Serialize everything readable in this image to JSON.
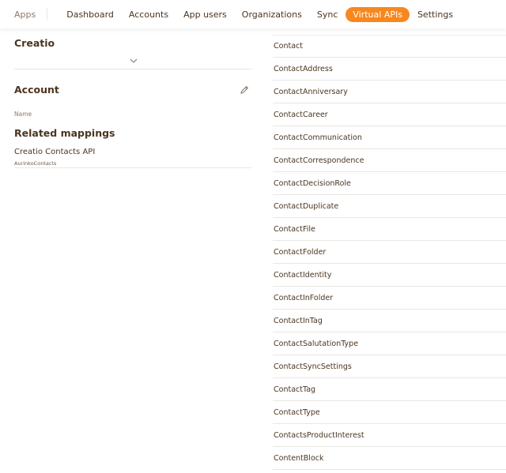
{
  "nav": {
    "apps_label": "Apps",
    "items": [
      {
        "label": "Dashboard",
        "active": false
      },
      {
        "label": "Accounts",
        "active": false
      },
      {
        "label": "App users",
        "active": false
      },
      {
        "label": "Organizations",
        "active": false
      },
      {
        "label": "Sync",
        "active": false
      },
      {
        "label": "Virtual APIs",
        "active": true
      },
      {
        "label": "Settings",
        "active": false
      }
    ],
    "accent_color": "#f7881f"
  },
  "left_panel": {
    "provider_title": "Creatio",
    "section_title": "Account",
    "name_label": "Name",
    "related_title": "Related mappings",
    "mapping": {
      "title": "Creatio Contacts API",
      "subtitle": "AurinkoContacts"
    }
  },
  "entities": [
    "Contact",
    "ContactAddress",
    "ContactAnniversary",
    "ContactCareer",
    "ContactCommunication",
    "ContactCorrespondence",
    "ContactDecisionRole",
    "ContactDuplicate",
    "ContactFile",
    "ContactFolder",
    "ContactIdentity",
    "ContactInFolder",
    "ContactInTag",
    "ContactSalutationType",
    "ContactSyncSettings",
    "ContactTag",
    "ContactType",
    "ContactsProductInterest",
    "ContentBlock"
  ]
}
